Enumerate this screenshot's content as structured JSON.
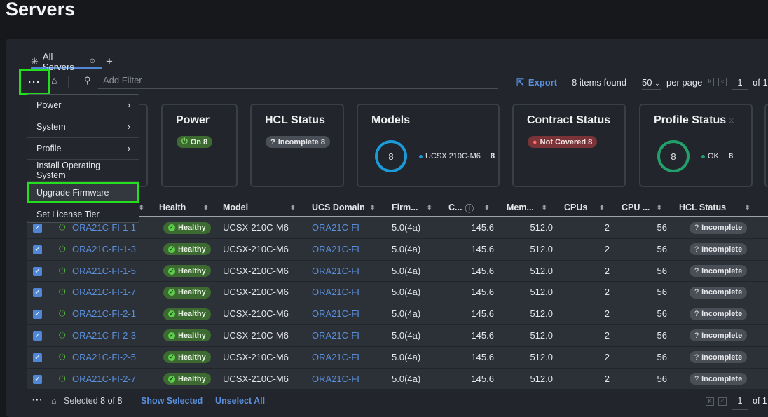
{
  "page": {
    "title": "Servers"
  },
  "tabs": [
    {
      "label": "All Servers",
      "icon": "asterisk-icon"
    }
  ],
  "toolbar": {
    "filter_placeholder": "Add Filter",
    "export_label": "Export",
    "items_found": "8 items found",
    "per_page_value": "50",
    "per_page_label": "per page",
    "page": "1",
    "of_pages": "of 1"
  },
  "menu": {
    "items": [
      {
        "label": "Power",
        "submenu": true
      },
      {
        "label": "System",
        "submenu": true
      },
      {
        "label": "Profile",
        "submenu": true
      },
      {
        "label": "Install Operating System"
      },
      {
        "label": "Upgrade Firmware",
        "highlighted": true
      },
      {
        "label": "Set License Tier"
      }
    ]
  },
  "cards": {
    "power": {
      "title": "Power",
      "badge": "On 8"
    },
    "hcl": {
      "title": "HCL Status",
      "badge": "Incomplete 8"
    },
    "models": {
      "title": "Models",
      "total": "8",
      "legend": "UCSX 210C-M6",
      "count": "8",
      "color": "#1a9ad6"
    },
    "contract": {
      "title": "Contract Status",
      "badge": "Not Covered 8"
    },
    "profile": {
      "title": "Profile Status",
      "total": "8",
      "legend": "OK",
      "count": "8",
      "color": "#22a06b"
    }
  },
  "table": {
    "columns": [
      "Health",
      "Model",
      "UCS Domain",
      "Firm...",
      "C...",
      "Mem...",
      "CPUs",
      "CPU ...",
      "HCL Status"
    ],
    "rows": [
      {
        "name": "ORA21C-FI-1-1",
        "health": "Healthy",
        "model": "UCSX-210C-M6",
        "domain": "ORA21C-FI",
        "firmware": "5.0(4a)",
        "c": "145.6",
        "mem": "512.0",
        "cpus": "2",
        "cores": "56",
        "hcl": "Incomplete",
        "selected": true
      },
      {
        "name": "ORA21C-FI-1-3",
        "health": "Healthy",
        "model": "UCSX-210C-M6",
        "domain": "ORA21C-FI",
        "firmware": "5.0(4a)",
        "c": "145.6",
        "mem": "512.0",
        "cpus": "2",
        "cores": "56",
        "hcl": "Incomplete",
        "selected": true
      },
      {
        "name": "ORA21C-FI-1-5",
        "health": "Healthy",
        "model": "UCSX-210C-M6",
        "domain": "ORA21C-FI",
        "firmware": "5.0(4a)",
        "c": "145.6",
        "mem": "512.0",
        "cpus": "2",
        "cores": "56",
        "hcl": "Incomplete",
        "selected": true
      },
      {
        "name": "ORA21C-FI-1-7",
        "health": "Healthy",
        "model": "UCSX-210C-M6",
        "domain": "ORA21C-FI",
        "firmware": "5.0(4a)",
        "c": "145.6",
        "mem": "512.0",
        "cpus": "2",
        "cores": "56",
        "hcl": "Incomplete",
        "selected": true
      },
      {
        "name": "ORA21C-FI-2-1",
        "health": "Healthy",
        "model": "UCSX-210C-M6",
        "domain": "ORA21C-FI",
        "firmware": "5.0(4a)",
        "c": "145.6",
        "mem": "512.0",
        "cpus": "2",
        "cores": "56",
        "hcl": "Incomplete",
        "selected": true
      },
      {
        "name": "ORA21C-FI-2-3",
        "health": "Healthy",
        "model": "UCSX-210C-M6",
        "domain": "ORA21C-FI",
        "firmware": "5.0(4a)",
        "c": "145.6",
        "mem": "512.0",
        "cpus": "2",
        "cores": "56",
        "hcl": "Incomplete",
        "selected": true
      },
      {
        "name": "ORA21C-FI-2-5",
        "health": "Healthy",
        "model": "UCSX-210C-M6",
        "domain": "ORA21C-FI",
        "firmware": "5.0(4a)",
        "c": "145.6",
        "mem": "512.0",
        "cpus": "2",
        "cores": "56",
        "hcl": "Incomplete",
        "selected": true
      },
      {
        "name": "ORA21C-FI-2-7",
        "health": "Healthy",
        "model": "UCSX-210C-M6",
        "domain": "ORA21C-FI",
        "firmware": "5.0(4a)",
        "c": "145.6",
        "mem": "512.0",
        "cpus": "2",
        "cores": "56",
        "hcl": "Incomplete",
        "selected": true
      }
    ]
  },
  "footer": {
    "selected_label": "Selected",
    "selected_count": "8 of 8",
    "show_selected": "Show Selected",
    "unselect_all": "Unselect All",
    "page": "1",
    "of_pages": "of 1"
  }
}
